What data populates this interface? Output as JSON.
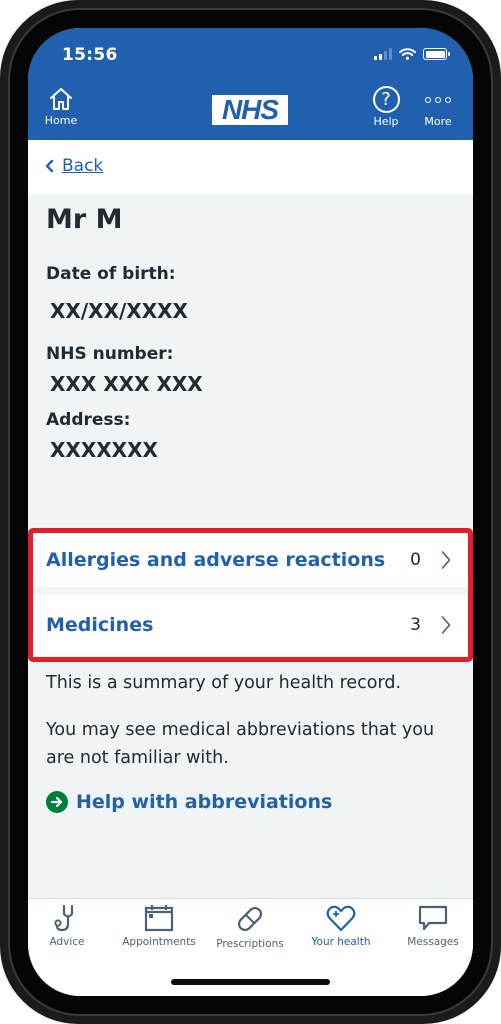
{
  "status_bar": {
    "time": "15:56",
    "signal_bars_active": 2,
    "signal_bars_total": 4,
    "wifi": "wifi-icon",
    "battery": "battery-icon"
  },
  "header": {
    "home_label": "Home",
    "logo_text": "NHS",
    "help_label": "Help",
    "more_label": "More"
  },
  "back_link": {
    "label": "Back"
  },
  "patient": {
    "name": "Mr M",
    "dob_label": "Date of birth:",
    "dob_value": "XX/XX/XXXX",
    "nhs_number_label": "NHS number:",
    "nhs_number_value": "XXX XXX XXX",
    "address_label": "Address:",
    "address_value": "XXXXXXX"
  },
  "record_items": [
    {
      "title": "Allergies and adverse reactions",
      "count": "0"
    },
    {
      "title": "Medicines",
      "count": "3"
    }
  ],
  "summary_text": "This is a summary of your health record.",
  "abbreviations_text": "You may see medical abbreviations that you are not familiar with.",
  "help_link": {
    "label": "Help with abbreviations"
  },
  "tab_bar": {
    "tabs": [
      {
        "label": "Advice",
        "icon": "stethoscope-icon",
        "active": false
      },
      {
        "label": "Appointments",
        "icon": "calendar-icon",
        "active": false
      },
      {
        "label": "Prescriptions",
        "icon": "pill-icon",
        "active": false
      },
      {
        "label": "Your health",
        "icon": "heart-plus-icon",
        "active": true
      },
      {
        "label": "Messages",
        "icon": "speech-bubble-icon",
        "active": false
      }
    ]
  },
  "colors": {
    "brand_blue": "#2160ae",
    "highlight_red": "#e21e2d",
    "link_green": "#007f3b",
    "background": "#f0f4f5",
    "text": "#212b32"
  }
}
